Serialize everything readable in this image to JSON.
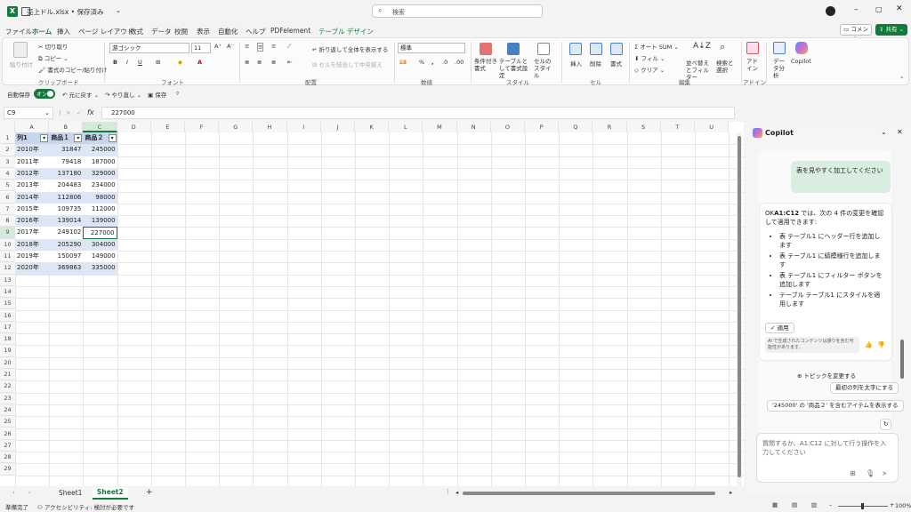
{
  "titlebar": {
    "filename": "売上ドル.xlsx • 保存済み",
    "search_placeholder": "検索"
  },
  "tabs": [
    "ファイル",
    "ホーム",
    "挿入",
    "ページ レイアウト",
    "数式",
    "データ",
    "校閲",
    "表示",
    "自動化",
    "ヘルプ",
    "PDFelement",
    "テーブル デザイン"
  ],
  "right_buttons": {
    "comment": "コメント",
    "share": "共有"
  },
  "ribbon": {
    "paste": "貼り付け",
    "cut": "切り取り",
    "copy": "コピー",
    "format_painter": "書式のコピー/貼り付け",
    "clipboard": "クリップボード",
    "font_name": "游ゴシック",
    "font_size": "11",
    "font_group": "フォント",
    "wrap": "折り返して全体を表示する",
    "merge": "セルを結合して中央揃え",
    "align_group": "配置",
    "number_format": "標準",
    "number_group": "数値",
    "cond_format": "条件付き書式",
    "table_format": "テーブルとして書式設定",
    "cell_style": "セルのスタイル",
    "style_group": "スタイル",
    "insert": "挿入",
    "delete": "削除",
    "format": "書式",
    "cell_group": "セル",
    "autosum": "オート SUM",
    "fill": "フィル",
    "clear": "クリア",
    "sort": "並べ替えとフィルター",
    "find": "検索と選択",
    "edit_group": "編集",
    "addin": "アドイン",
    "addin_group": "アドイン",
    "analyze": "データ分析",
    "copilot": "Copilot"
  },
  "quickaccess": {
    "autosave": "自動保存",
    "on": "オン",
    "undo": "元に戻す",
    "redo": "やり直し",
    "save": "保存"
  },
  "formula": {
    "namebox": "C9",
    "fx": "fx",
    "value": "227000"
  },
  "columns": [
    "A",
    "B",
    "C",
    "D",
    "E",
    "F",
    "G",
    "H",
    "I",
    "J",
    "K",
    "L",
    "M",
    "N",
    "O",
    "P",
    "Q",
    "R",
    "S",
    "T",
    "U"
  ],
  "headers": [
    "列1",
    "商品１",
    "商品２"
  ],
  "rows": [
    [
      "2010年",
      "31847",
      "245000"
    ],
    [
      "2011年",
      "79418",
      "187000"
    ],
    [
      "2012年",
      "137180",
      "329000"
    ],
    [
      "2013年",
      "204483",
      "234000"
    ],
    [
      "2014年",
      "112806",
      "98000"
    ],
    [
      "2015年",
      "109735",
      "112000"
    ],
    [
      "2016年",
      "139014",
      "139000"
    ],
    [
      "2017年",
      "249102",
      "227000"
    ],
    [
      "2018年",
      "205290",
      "304000"
    ],
    [
      "2019年",
      "150097",
      "149000"
    ],
    [
      "2020年",
      "369863",
      "335000"
    ]
  ],
  "sheets": [
    "Sheet1",
    "Sheet2"
  ],
  "status": {
    "ready": "準備完了",
    "accessibility": "アクセシビリティ: 検討が必要です",
    "zoom": "100%"
  },
  "copilot": {
    "title": "Copilot",
    "user_msg": "表を見やすく加工してください",
    "reply_prefix": "OK",
    "reply_range": "A1:C12",
    "reply_rest": " では、次の 4 件の変更を確認して適用できます:",
    "items": [
      "表 テーブル1 にヘッダー行を追加します",
      "表 テーブル1 に縞模様行を追加します",
      "表 テーブル1 にフィルター ボタンを追加します",
      "テーブル テーブル1 にスタイルを適用します"
    ],
    "apply": "適用",
    "disclaimer": "AI で生成されたコンテンツは誤りを含む可能性があります。",
    "change_topic": "トピックを変更する",
    "suggest1": "最初の列を太字にする",
    "suggest2": "'245000' の '商品２' を含むアイテムを表示する",
    "input_placeholder": "質問するか、A1:C12 に対して行う操作を入力してください"
  }
}
